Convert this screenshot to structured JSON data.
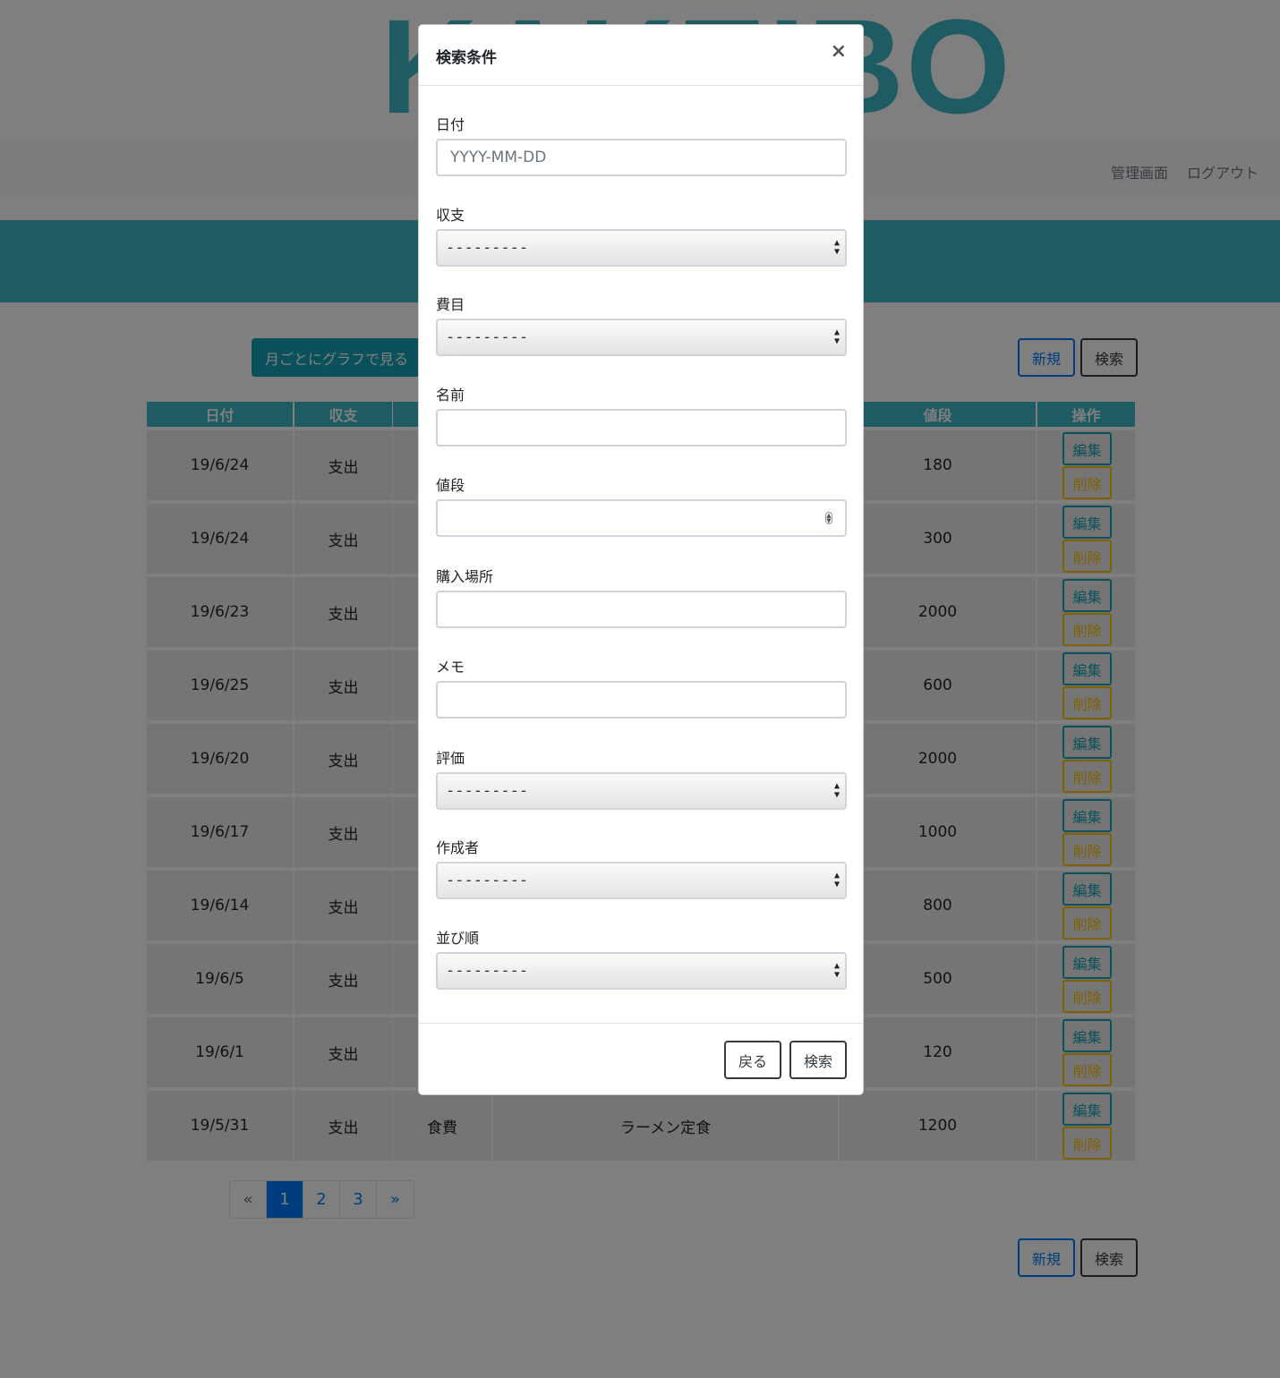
{
  "header": {
    "logo_text": "KAKEIBO",
    "nav": [
      "管理画面",
      "ログアウト"
    ]
  },
  "toolbar": {
    "graph_label": "月ごとにグラフで見る",
    "new_label": "新規",
    "search_label": "検索"
  },
  "table": {
    "visible_headers": [
      {
        "key": "date",
        "label": "日付"
      },
      {
        "key": "type",
        "label": "収支"
      },
      {
        "key": "price",
        "label": "値段"
      },
      {
        "key": "actions",
        "label": "操作"
      }
    ],
    "rows": [
      {
        "date": "19/6/24",
        "type": "支出",
        "price": "180"
      },
      {
        "date": "19/6/24",
        "type": "支出",
        "price": "300"
      },
      {
        "date": "19/6/23",
        "type": "支出",
        "price": "2000"
      },
      {
        "date": "19/6/25",
        "type": "支出",
        "price": "600"
      },
      {
        "date": "19/6/20",
        "type": "支出",
        "price": "2000"
      },
      {
        "date": "19/6/17",
        "type": "支出",
        "price": "1000"
      },
      {
        "date": "19/6/14",
        "type": "支出",
        "price": "800"
      },
      {
        "date": "19/6/5",
        "type": "支出",
        "price": "500"
      },
      {
        "date": "19/6/1",
        "type": "支出",
        "price": "120"
      },
      {
        "date": "19/5/31",
        "type": "支出",
        "category": "食費",
        "name": "ラーメン定食",
        "price": "1200"
      }
    ],
    "edit_label": "編集",
    "delete_label": "削除"
  },
  "pagination": {
    "prev": "«",
    "pages": [
      "1",
      "2",
      "3"
    ],
    "active": "1",
    "next": "»"
  },
  "modal": {
    "title": "検索条件",
    "close": "×",
    "fields": [
      {
        "label": "日付",
        "type": "text",
        "placeholder": "YYYY-MM-DD",
        "value": ""
      },
      {
        "label": "収支",
        "type": "select",
        "value": "---------"
      },
      {
        "label": "費目",
        "type": "select",
        "value": "---------"
      },
      {
        "label": "名前",
        "type": "text",
        "placeholder": "",
        "value": ""
      },
      {
        "label": "値段",
        "type": "number",
        "placeholder": "",
        "value": ""
      },
      {
        "label": "購入場所",
        "type": "text",
        "placeholder": "",
        "value": ""
      },
      {
        "label": "メモ",
        "type": "text",
        "placeholder": "",
        "value": ""
      },
      {
        "label": "評価",
        "type": "select",
        "value": "---------"
      },
      {
        "label": "作成者",
        "type": "select",
        "value": "---------"
      },
      {
        "label": "並び順",
        "type": "select",
        "value": "---------"
      }
    ],
    "back_label": "戻る",
    "search_label": "検索"
  }
}
